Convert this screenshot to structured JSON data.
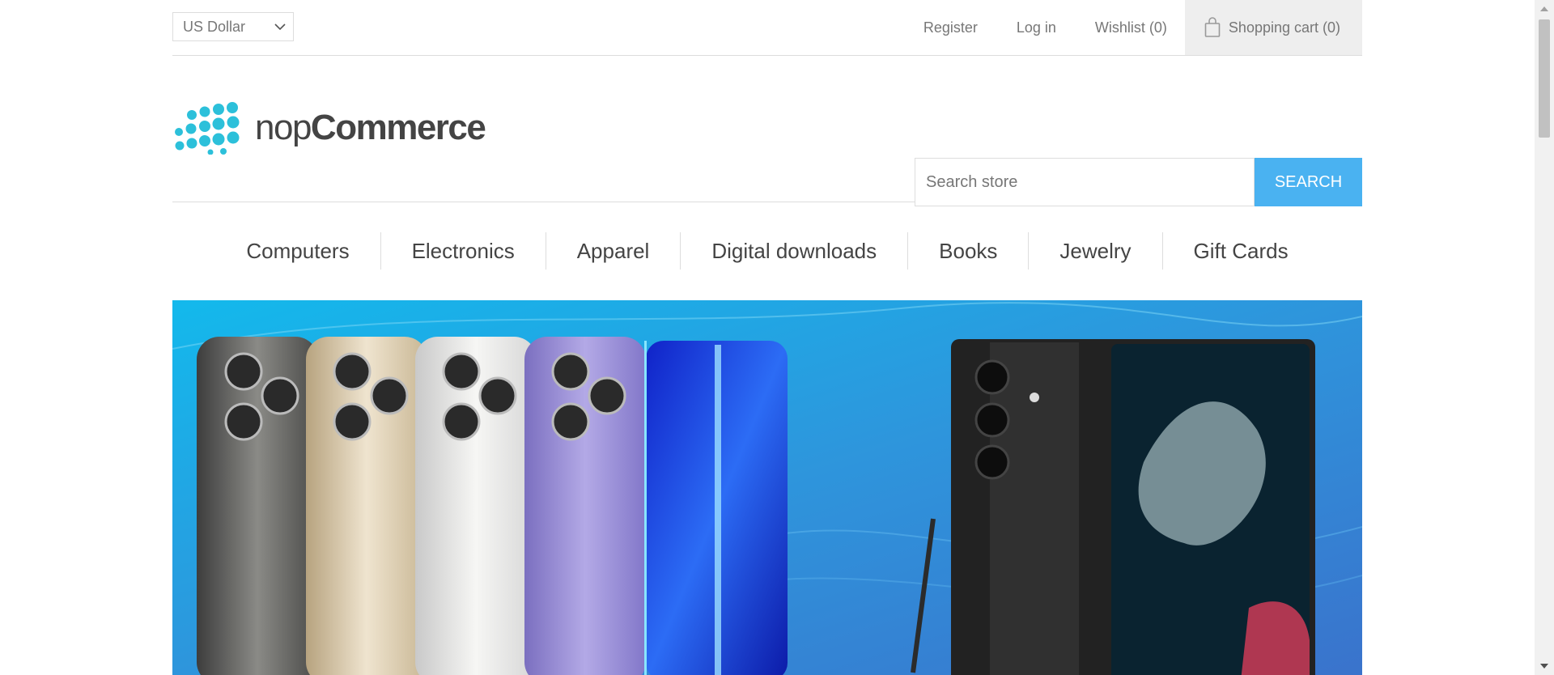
{
  "header": {
    "currency": {
      "selected": "US Dollar",
      "icon": "chevron-down-icon"
    },
    "links": {
      "register": "Register",
      "login": "Log in",
      "wishlist": "Wishlist (0)",
      "cart": "Shopping cart (0)",
      "cart_icon": "shopping-bag-icon"
    }
  },
  "logo": {
    "brand_part1": "nop",
    "brand_part2": "Commerce"
  },
  "search": {
    "placeholder": "Search store",
    "button_label": "SEARCH"
  },
  "menu": {
    "items": [
      "Computers",
      "Electronics",
      "Apparel",
      "Digital downloads",
      "Books",
      "Jewelry",
      "Gift Cards"
    ]
  },
  "colors": {
    "accent": "#4ab2f1",
    "logo_dots": "#2cc0da",
    "banner_bg": "#2a9fe0"
  }
}
